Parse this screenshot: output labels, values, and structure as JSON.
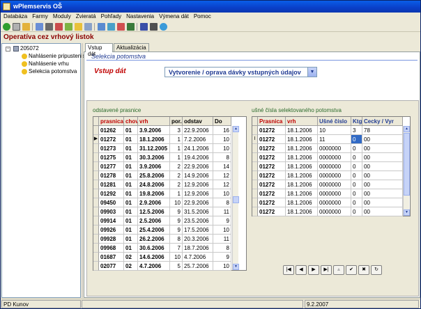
{
  "window": {
    "title": "wPlemservis OŠ"
  },
  "menu": [
    "Databáza",
    "Farmy",
    "Moduly",
    "Zvieratá",
    "Pohľady",
    "Nastavenia",
    "Výmena dát",
    "Pomoc"
  ],
  "app_heading": "Operatíva cez vrhový listok",
  "tree": {
    "root": "205072",
    "items": [
      "Nahlásenie pripustenia",
      "Nahlásenie vrhu",
      "Selekcia potomstva"
    ]
  },
  "tabs": [
    "Vstup dát",
    "Aktualizácia"
  ],
  "section_title": "Selekcia potomstva",
  "vstup_label": "Vstup dát",
  "combo_value": "Vytvorenie / oprava dávky vstupných údajov",
  "left_grid": {
    "label": "odstavené prasnice",
    "columns": [
      "prasnica",
      "chov",
      "vrh",
      "por.",
      "odstav",
      "Do"
    ],
    "rows": [
      [
        "01262",
        "01",
        "3.9.2006",
        "3",
        "22.9.2006",
        "16"
      ],
      [
        "01272",
        "01",
        "18.1.2006",
        "1",
        "7.2.2006",
        "10"
      ],
      [
        "01273",
        "01",
        "31.12.2005",
        "1",
        "24.1.2006",
        "10"
      ],
      [
        "01275",
        "01",
        "30.3.2006",
        "1",
        "19.4.2006",
        "8"
      ],
      [
        "01277",
        "01",
        "3.9.2006",
        "2",
        "22.9.2006",
        "14"
      ],
      [
        "01278",
        "01",
        "25.8.2006",
        "2",
        "14.9.2006",
        "12"
      ],
      [
        "01281",
        "01",
        "24.8.2006",
        "2",
        "12.9.2006",
        "12"
      ],
      [
        "01292",
        "01",
        "19.8.2006",
        "1",
        "12.9.2006",
        "10"
      ],
      [
        "09450",
        "01",
        "2.9.2006",
        "10",
        "22.9.2006",
        "8"
      ],
      [
        "09903",
        "01",
        "12.5.2006",
        "9",
        "31.5.2006",
        "11"
      ],
      [
        "09914",
        "01",
        "2.5.2006",
        "9",
        "23.5.2006",
        "9"
      ],
      [
        "09926",
        "01",
        "25.4.2006",
        "9",
        "17.5.2006",
        "10"
      ],
      [
        "09928",
        "01",
        "26.2.2006",
        "8",
        "20.3.2006",
        "11"
      ],
      [
        "09968",
        "01",
        "30.6.2006",
        "7",
        "18.7.2006",
        "8"
      ],
      [
        "01687",
        "02",
        "14.6.2006",
        "10",
        "4.7.2006",
        "9"
      ],
      [
        "02077",
        "02",
        "4.7.2006",
        "5",
        "25.7.2006",
        "10"
      ]
    ]
  },
  "right_grid": {
    "label": "ušné čísla selektovaného potomstva",
    "columns": [
      "Prasnica",
      "vrh",
      "Ušné číslo",
      "Ktg",
      "Cecky / Vyr"
    ],
    "rows": [
      [
        "01272",
        "18.1.2006",
        "10",
        "3",
        "78"
      ],
      [
        "01272",
        "18.1.2006",
        "11",
        "0",
        "00"
      ],
      [
        "01272",
        "18.1.2006",
        "0000000",
        "0",
        "00"
      ],
      [
        "01272",
        "18.1.2006",
        "0000000",
        "0",
        "00"
      ],
      [
        "01272",
        "18.1.2006",
        "0000000",
        "0",
        "00"
      ],
      [
        "01272",
        "18.1.2006",
        "0000000",
        "0",
        "00"
      ],
      [
        "01272",
        "18.1.2006",
        "0000000",
        "0",
        "00"
      ],
      [
        "01272",
        "18.1.2006",
        "0000000",
        "0",
        "00"
      ],
      [
        "01272",
        "18.1.2006",
        "0000000",
        "0",
        "00"
      ],
      [
        "01272",
        "18.1.2006",
        "0000000",
        "0",
        "00"
      ]
    ]
  },
  "status": {
    "user": "PD Kunov",
    "middle": "",
    "date": "9.2.2007"
  },
  "colors": {
    "accent_red": "#c00000",
    "accent_blue": "#1f3a93",
    "title_blue": "#0a3fc8"
  }
}
